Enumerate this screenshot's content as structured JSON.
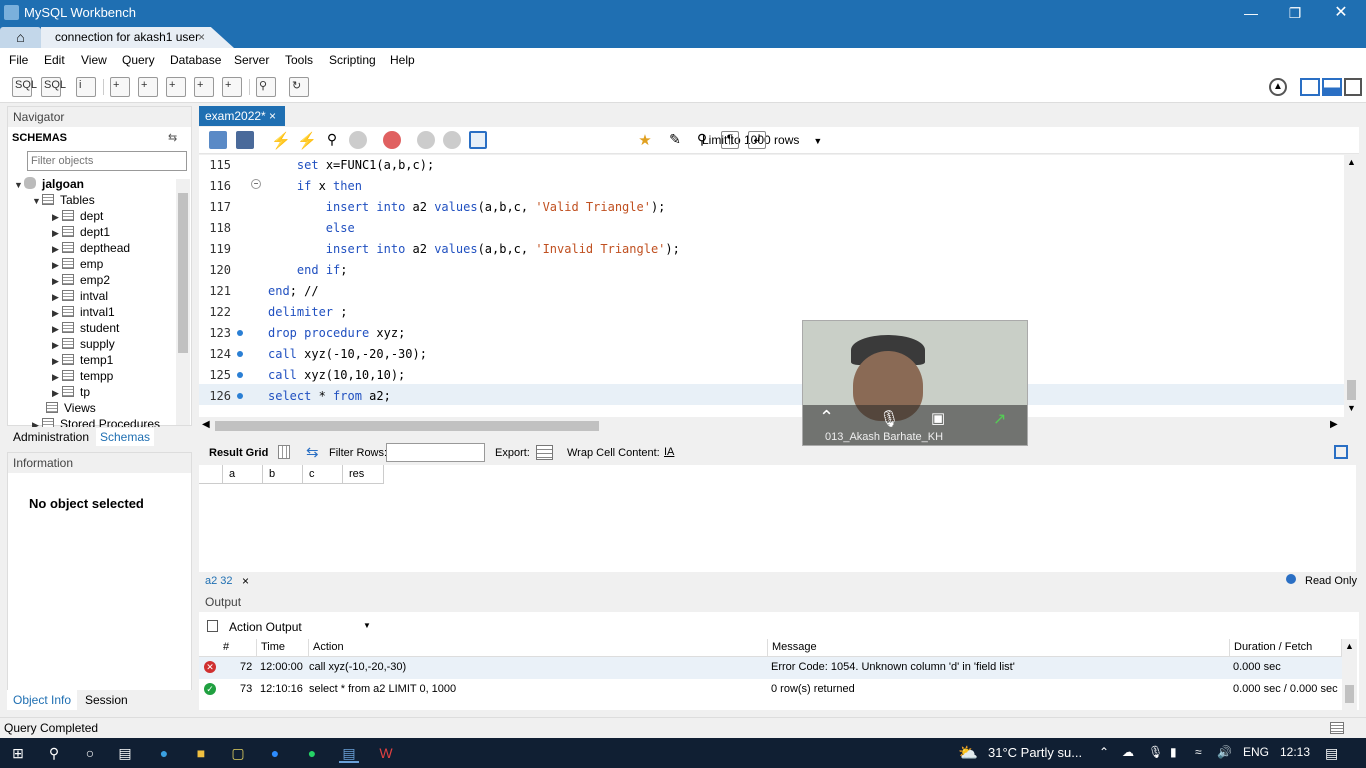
{
  "window": {
    "title": "MySQL Workbench"
  },
  "tabs": {
    "home_icon": "home-icon",
    "connection_tab": "connection for akash1 user",
    "close": "×"
  },
  "menu": {
    "items": [
      "File",
      "Edit",
      "View",
      "Query",
      "Database",
      "Server",
      "Tools",
      "Scripting",
      "Help"
    ]
  },
  "navigator": {
    "title": "Navigator",
    "schemas_label": "SCHEMAS",
    "filter_placeholder": "Filter objects",
    "schema": "jalgoan",
    "tables_label": "Tables",
    "tables": [
      "dept",
      "dept1",
      "depthead",
      "emp",
      "emp2",
      "intval",
      "intval1",
      "student",
      "supply",
      "temp1",
      "tempp",
      "tp"
    ],
    "views_label": "Views",
    "stored_procedures_label": "Stored Procedures",
    "tab_administration": "Administration",
    "tab_schemas": "Schemas"
  },
  "information": {
    "title": "Information",
    "message": "No object selected",
    "tab_object_info": "Object Info",
    "tab_session": "Session"
  },
  "editor": {
    "tab_label": "exam2022*",
    "limit_label": "Limit to 1000 rows",
    "lines": [
      {
        "num": "115",
        "code": "    set x=FUNC1(a,b,c);"
      },
      {
        "num": "116",
        "code": "    if x then"
      },
      {
        "num": "117",
        "code": "        insert into a2 values(a,b,c, 'Valid Triangle');"
      },
      {
        "num": "118",
        "code": "        else"
      },
      {
        "num": "119",
        "code": "        insert into a2 values(a,b,c, 'Invalid Triangle');"
      },
      {
        "num": "120",
        "code": "    end if;"
      },
      {
        "num": "121",
        "code": "end; //"
      },
      {
        "num": "122",
        "code": "delimiter ;"
      },
      {
        "num": "123",
        "code": "drop procedure xyz;"
      },
      {
        "num": "124",
        "code": "call xyz(-10,-20,-30);"
      },
      {
        "num": "125",
        "code": "call xyz(10,10,10);"
      },
      {
        "num": "126",
        "code": "select * from a2;"
      }
    ]
  },
  "result": {
    "grid_label": "Result Grid",
    "filter_label": "Filter Rows:",
    "export_label": "Export:",
    "wrap_label": "Wrap Cell Content:",
    "columns": [
      "a",
      "b",
      "c",
      "res"
    ],
    "tab_label": "a2 32",
    "readonly_label": "Read Only"
  },
  "output": {
    "title": "Output",
    "selector": "Action Output",
    "columns": [
      "#",
      "Time",
      "Action",
      "Message",
      "Duration / Fetch"
    ],
    "rows": [
      {
        "status": "error",
        "num": "72",
        "time": "12:00:00",
        "action": "call xyz(-10,-20,-30)",
        "message": "Error Code: 1054. Unknown column 'd' in 'field list'",
        "duration": "0.000 sec"
      },
      {
        "status": "ok",
        "num": "73",
        "time": "12:10:16",
        "action": "select * from a2 LIMIT 0, 1000",
        "message": "0 row(s) returned",
        "duration": "0.000 sec / 0.000 sec"
      }
    ]
  },
  "status": {
    "text": "Query Completed"
  },
  "video": {
    "participant": "013_Akash Barhate_KH"
  },
  "taskbar": {
    "weather": "31°C  Partly su...",
    "language": "ENG",
    "time": "12:13"
  }
}
